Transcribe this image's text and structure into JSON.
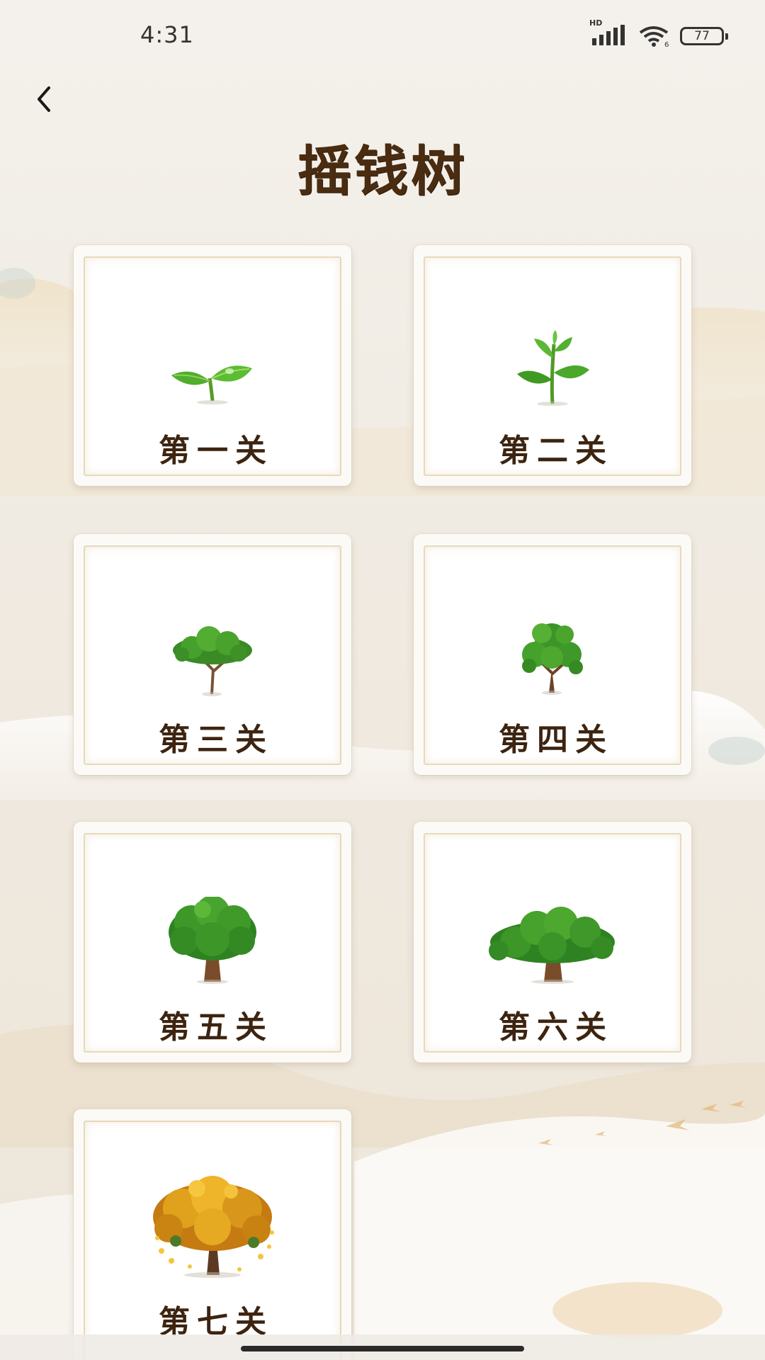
{
  "status_bar": {
    "time": "4:31",
    "network_label": "HD",
    "battery_level": "77"
  },
  "header": {
    "back_icon": "chevron-left-icon",
    "title": "摇钱树"
  },
  "levels": [
    {
      "label": "第一关",
      "icon": "seedling-sprout-icon"
    },
    {
      "label": "第二关",
      "icon": "young-plant-icon"
    },
    {
      "label": "第三关",
      "icon": "small-tree-icon"
    },
    {
      "label": "第四关",
      "icon": "growing-tree-icon"
    },
    {
      "label": "第五关",
      "icon": "leafy-tree-icon"
    },
    {
      "label": "第六关",
      "icon": "large-tree-icon"
    },
    {
      "label": "第七关",
      "icon": "golden-money-tree-icon"
    }
  ],
  "colors": {
    "title": "#4a2c10",
    "label": "#3d2410",
    "card_border": "#e8d9bb",
    "leaf_green": "#3f9a2e",
    "gold": "#e8a81c"
  }
}
